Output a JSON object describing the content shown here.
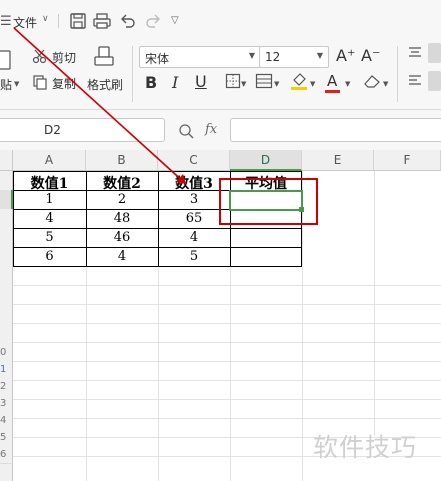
{
  "menubar": {
    "hamburger": "☰",
    "file_label": "文件",
    "file_arrow": "∨",
    "more_arrow": "▽"
  },
  "ribbon": {
    "paste_label": "贴",
    "cut_label": "剪切",
    "copy_label": "复制",
    "format_painter_label": "格式刷",
    "font_name": "宋体",
    "font_size": "12",
    "grow_font": "A⁺",
    "shrink_font": "A⁻",
    "bold": "B",
    "italic": "I",
    "underline": "U",
    "font_color_letter": "A"
  },
  "formula_bar": {
    "name_box": "D2",
    "fx_label": "fx",
    "formula_value": ""
  },
  "sheet": {
    "columns": [
      "A",
      "B",
      "C",
      "D",
      "E",
      "F"
    ],
    "active_column": "D",
    "row_numbers": [
      "0",
      "1",
      "2",
      "3",
      "4",
      "5",
      "6"
    ],
    "table": {
      "headers": [
        "数值1",
        "数值2",
        "数值3",
        "平均值"
      ],
      "rows": [
        [
          "1",
          "2",
          "3",
          ""
        ],
        [
          "4",
          "48",
          "65",
          ""
        ],
        [
          "5",
          "46",
          "4",
          ""
        ],
        [
          "6",
          "4",
          "5",
          ""
        ]
      ]
    }
  },
  "watermark": "软件技巧",
  "colors": {
    "accent_green": "#4b9a4b",
    "annotation_red": "#cc0000",
    "font_color_red": "#e02020",
    "fill_yellow": "#f5d000"
  }
}
